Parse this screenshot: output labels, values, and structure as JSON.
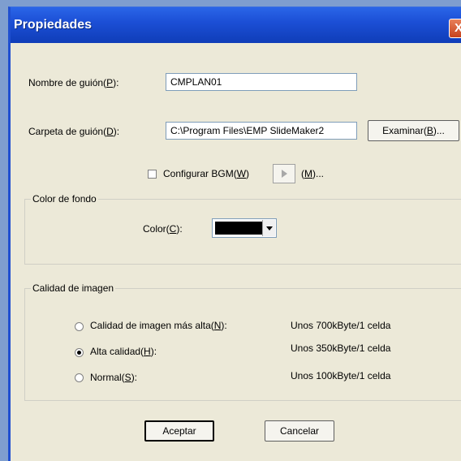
{
  "dialog": {
    "title": "Propiedades",
    "close_glyph": "X"
  },
  "fields": {
    "script_name_label": "Nombre de guión(P):",
    "script_name_value": "CMPLAN01",
    "script_folder_label": "Carpeta de guión(D):",
    "script_folder_value": "C:\\Program Files\\EMP SlideMaker2",
    "browse_button": "Examinar(B)..."
  },
  "bgm": {
    "checkbox_label": "Configurar BGM(W)",
    "checked": false,
    "menu_button": "(M)..."
  },
  "background_color": {
    "group_title": "Color de fondo",
    "color_label": "Color(C):",
    "selected_color": "#000000"
  },
  "image_quality": {
    "group_title": "Calidad de imagen",
    "options": [
      {
        "label": "Calidad de imagen más alta(N):",
        "size": "Unos 700kByte/1 celda",
        "selected": false
      },
      {
        "label": "Alta calidad(H):",
        "size": "Unos 350kByte/1 celda",
        "selected": true
      },
      {
        "label": "Normal(S):",
        "size": "Unos 100kByte/1 celda",
        "selected": false
      }
    ]
  },
  "buttons": {
    "ok": "Aceptar",
    "cancel": "Cancelar"
  },
  "colors": {
    "dialog_bg": "#ece9d8",
    "titlebar": "#1c4fd6",
    "desktop": "#7e9ecf"
  }
}
